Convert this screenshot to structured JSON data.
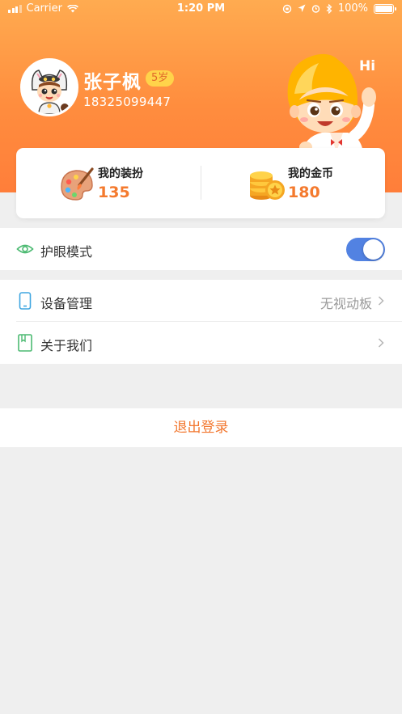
{
  "status_bar": {
    "carrier": "Carrier",
    "time": "1:20 PM",
    "battery": "100%",
    "battery_level": 1.0
  },
  "profile": {
    "name": "张子枫",
    "age_badge": "5岁",
    "phone": "18325099447",
    "greeting": "Hi",
    "avatar_icon": "cat-costume-kid-avatar",
    "mascot_icon": "waving-mascot-character"
  },
  "stats": {
    "outfits": {
      "label": "我的装扮",
      "value": "135",
      "icon": "palette-icon"
    },
    "coins": {
      "label": "我的金币",
      "value": "180",
      "icon": "coins-icon"
    }
  },
  "settings": {
    "eye_care": {
      "label": "护眼模式",
      "icon": "eye-icon",
      "enabled": true
    },
    "device": {
      "label": "设备管理",
      "value": "无视动板",
      "icon": "phone-icon"
    },
    "about": {
      "label": "关于我们",
      "icon": "book-icon"
    }
  },
  "logout": {
    "label": "退出登录"
  },
  "colors": {
    "header_top": "#ffab50",
    "header_bottom": "#ff7e3a",
    "accent": "#f47a2e",
    "toggle_on": "#5282e2",
    "icon_green": "#4cba72",
    "icon_blue": "#3fa6e0",
    "background": "#efefef"
  }
}
